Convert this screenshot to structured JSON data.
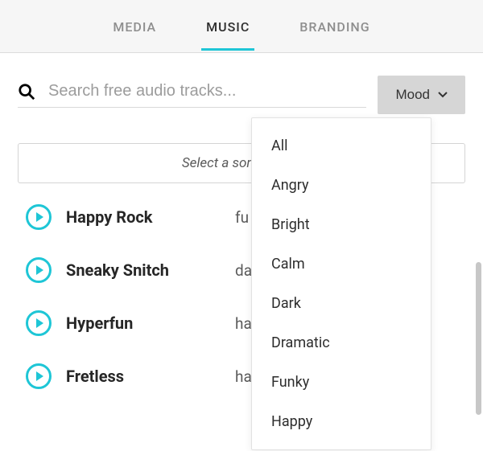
{
  "tabs": {
    "media": "MEDIA",
    "music": "MUSIC",
    "branding": "BRANDING"
  },
  "search": {
    "placeholder": "Search free audio tracks..."
  },
  "mood_button": "Mood",
  "prompt": "Select a song to use",
  "tracks": [
    {
      "title": "Happy Rock",
      "tag": "fu"
    },
    {
      "title": "Sneaky Snitch",
      "tag": "da"
    },
    {
      "title": "Hyperfun",
      "tag": "ha"
    },
    {
      "title": "Fretless",
      "tag": "ha"
    }
  ],
  "mood_options": [
    "All",
    "Angry",
    "Bright",
    "Calm",
    "Dark",
    "Dramatic",
    "Funky",
    "Happy"
  ]
}
